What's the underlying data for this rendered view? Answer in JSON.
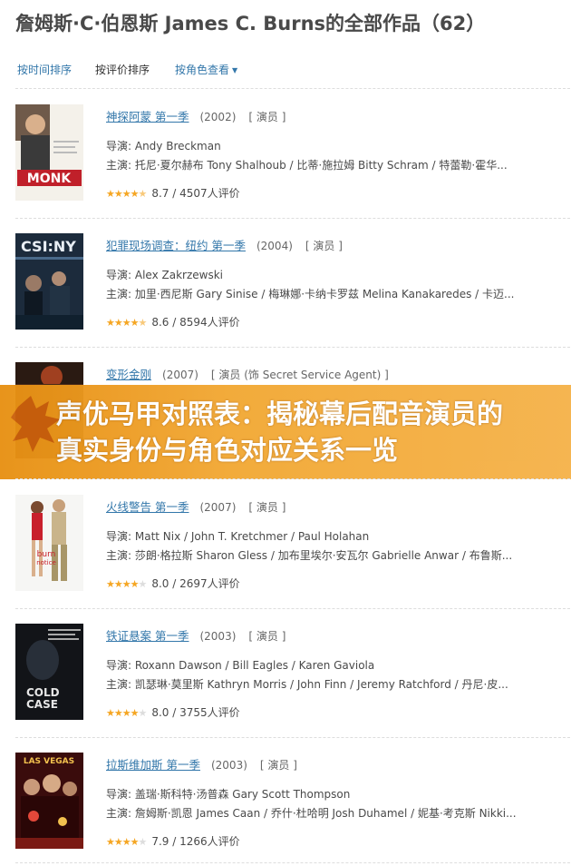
{
  "page": {
    "title": "詹姆斯·C·伯恩斯 James C. Burns的全部作品（62）"
  },
  "sort": {
    "by_time": "按时间排序",
    "by_rating": "按评价排序",
    "by_role": "按角色查看"
  },
  "labels": {
    "director_prefix": "导演: ",
    "cast_prefix": "主演: "
  },
  "colors": {
    "link": "#3377aa",
    "star": "#f5a623",
    "banner": "#f2a834"
  },
  "banner": {
    "text": "声优马甲对照表：揭秘幕后配音演员的真实身份与角色对应关系一览"
  },
  "items": [
    {
      "title": "神探阿蒙 第一季",
      "year": "(2002)",
      "role": "[ 演员 ]",
      "director": "Andy Breckman",
      "cast": "托尼·夏尔赫布 Tony Shalhoub / 比蒂·施拉姆 Bitty Schram / 特蕾勒·霍华...",
      "rating": "8.7 / 4507人评价",
      "stars": 4.5,
      "poster_icon": "monk-poster"
    },
    {
      "title": "犯罪现场调查：纽约 第一季",
      "year": "(2004)",
      "role": "[ 演员 ]",
      "director": "Alex Zakrzewski",
      "cast": "加里·西尼斯 Gary Sinise / 梅琳娜·卡纳卡罗兹 Melina Kanakaredes / 卡迈...",
      "rating": "8.6 / 8594人评价",
      "stars": 4.5,
      "poster_icon": "csi-ny-poster"
    },
    {
      "title": "变形金刚",
      "year": "(2007)",
      "role": "[ 演员 (饰 Secret Service Agent) ]",
      "director": "",
      "cast": "",
      "rating": "",
      "stars": 4,
      "poster_icon": "transformers-poster"
    },
    {
      "title": "火线警告 第一季",
      "year": "(2007)",
      "role": "[ 演员 ]",
      "director": "Matt Nix / John T. Kretchmer / Paul Holahan",
      "cast": "莎朗·格拉斯 Sharon Gless / 加布里埃尔·安瓦尔 Gabrielle Anwar / 布鲁斯...",
      "rating": "8.0 / 2697人评价",
      "stars": 4,
      "poster_icon": "burn-notice-poster"
    },
    {
      "title": "铁证悬案 第一季",
      "year": "(2003)",
      "role": "[ 演员 ]",
      "director": "Roxann Dawson / Bill Eagles / Karen Gaviola",
      "cast": "凯瑟琳·莫里斯 Kathryn Morris / John Finn / Jeremy Ratchford / 丹尼·皮...",
      "rating": "8.0 / 3755人评价",
      "stars": 4,
      "poster_icon": "cold-case-poster"
    },
    {
      "title": "拉斯维加斯 第一季",
      "year": "(2003)",
      "role": "[ 演员 ]",
      "director": "盖瑞·斯科特·汤普森 Gary Scott Thompson",
      "cast": "詹姆斯·凯恩 James Caan / 乔什·杜哈明 Josh Duhamel / 妮基·考克斯 Nikki...",
      "rating": "7.9 / 1266人评价",
      "stars": 4,
      "poster_icon": "las-vegas-poster"
    }
  ]
}
